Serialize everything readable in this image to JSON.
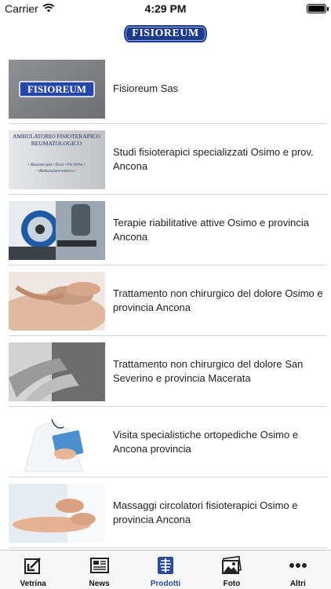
{
  "status_bar": {
    "carrier": "Carrier",
    "time": "4:29 PM"
  },
  "header": {
    "logo_text": "FISIOREUM"
  },
  "items": [
    {
      "label": "Fisioreum Sas",
      "thumb_text": "FISIOREUM"
    },
    {
      "label": "Studi fisioterapici specializzati Osimo e prov. Ancona",
      "thumb_text_1": "AMBULATORIO FISIOTERAPICO",
      "thumb_text_2": "REUMATOLOGICO",
      "thumb_text_3": "• Massoterapia • Tecar • Pst Ortho •",
      "thumb_text_4": "• Rieducazione motoria •"
    },
    {
      "label": "Terapie riabilitative attive Osimo e provincia Ancona"
    },
    {
      "label": "Trattamento non chirurgico del dolore Osimo e provincia Ancona"
    },
    {
      "label": "Trattamento non chirurgico del dolore San Severino e provincia Macerata"
    },
    {
      "label": "Visita specialistiche ortopediche Osimo e Ancona provincia"
    },
    {
      "label": "Massaggi circolatori fisioterapici Osimo e provincia Ancona"
    }
  ],
  "tabs": [
    {
      "label": "Vetrina",
      "icon": "vetrina-icon"
    },
    {
      "label": "News",
      "icon": "news-icon"
    },
    {
      "label": "Prodotti",
      "icon": "prodotti-icon",
      "active": true
    },
    {
      "label": "Foto",
      "icon": "foto-icon"
    },
    {
      "label": "Altri",
      "icon": "more-icon"
    }
  ],
  "colors": {
    "active_tab": "#2a4a9c",
    "brand": "#1d3b8c"
  }
}
